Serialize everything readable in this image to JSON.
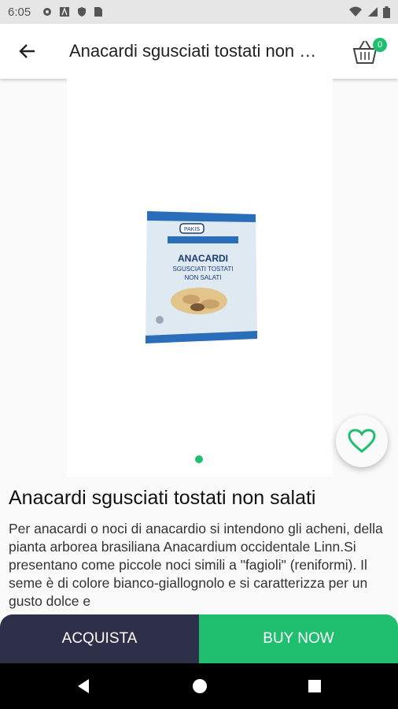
{
  "status_bar": {
    "time": "6:05",
    "icons": [
      "settings-icon",
      "a-icon",
      "shield-icon",
      "sim-icon",
      "wifi-icon",
      "signal-icon",
      "battery-icon"
    ]
  },
  "app_bar": {
    "title": "Anacardi sgusciati tostati non …",
    "cart_count": "0",
    "icons": [
      "back-arrow-icon",
      "basket-icon"
    ]
  },
  "product": {
    "image_icon": "product-bag-image",
    "package_text": {
      "brand": "PAKIS",
      "name": "ANACARDI",
      "line2": "SGUSCIATI TOSTATI",
      "line3": "NON SALATI"
    },
    "title": "Anacardi sgusciati tostati non salati",
    "description": "Per anacardi o noci di anacardio si intendono gli acheni, della pianta arborea brasiliana Anacardium occidentale Linn.Si presentano come piccole noci simili a \"fagioli\" (reniformi). Il seme è di colore bianco-giallognolo e si caratterizza per un gusto dolce e"
  },
  "actions": {
    "acquista": "ACQUISTA",
    "buy_now": "BUY NOW"
  },
  "colors": {
    "accent": "#1fbf6f",
    "dark_button": "#2e3049",
    "status_bar": "#e6e6e6"
  }
}
